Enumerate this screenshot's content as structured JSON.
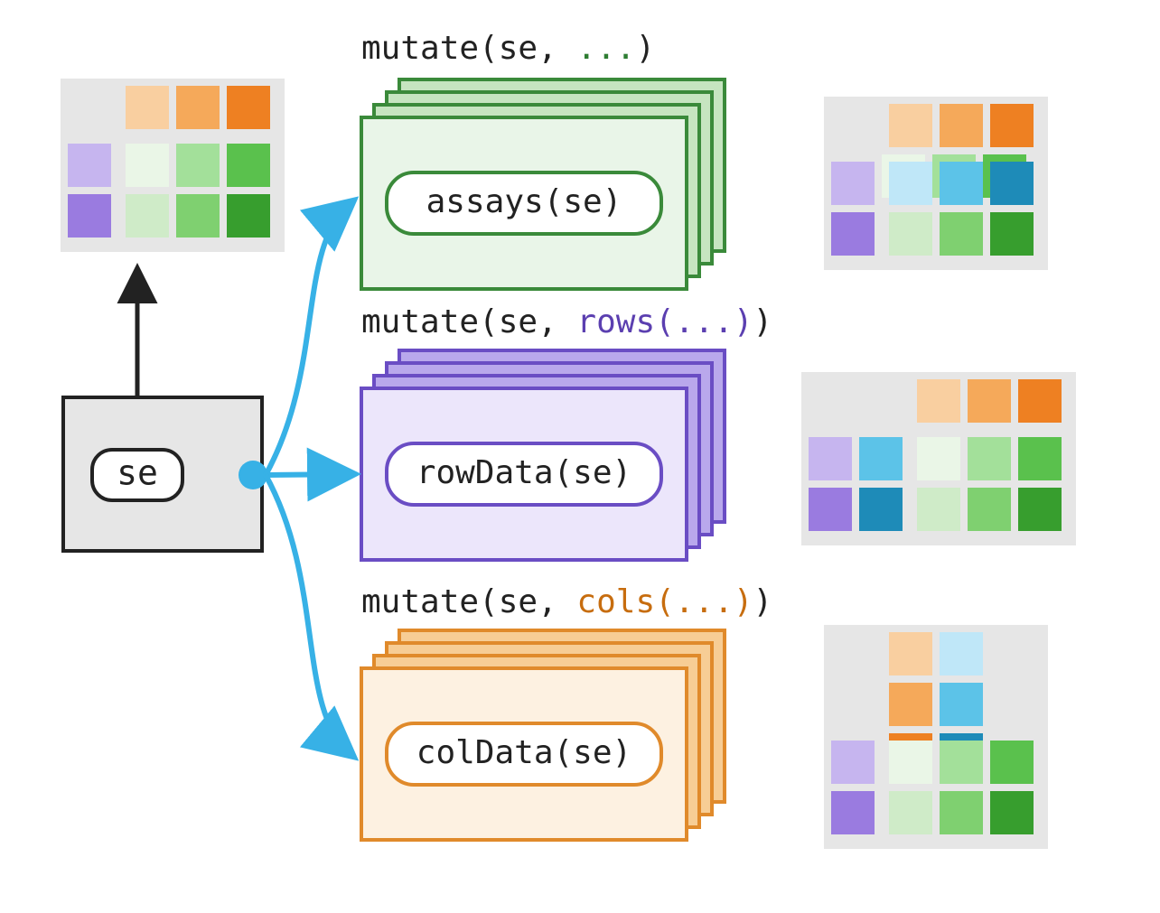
{
  "source": {
    "label": "se"
  },
  "targets": [
    {
      "id": "assays",
      "code": {
        "prefix": "mutate(se, ",
        "highlight": "...",
        "suffix": ")"
      },
      "pill": "assays(se)",
      "colors": {
        "stroke": "#3a8a3a",
        "fillLight": "#e9f5e8",
        "fillMid": "#c6e5c0",
        "text": "#2e7d32"
      }
    },
    {
      "id": "rowData",
      "code": {
        "prefix": "mutate(se, ",
        "highlight": "rows(...)",
        "suffix": ")"
      },
      "pill": "rowData(se)",
      "colors": {
        "stroke": "#6a4dc4",
        "fillLight": "#ece6fb",
        "fillMid": "#b9a8ec",
        "text": "#5b3fb0"
      }
    },
    {
      "id": "colData",
      "code": {
        "prefix": "mutate(se, ",
        "highlight": "cols(...)",
        "suffix": ")"
      },
      "pill": "colData(se)",
      "colors": {
        "stroke": "#e08a2b",
        "fillLight": "#fdf1e1",
        "fillMid": "#f7cd95",
        "text": "#c76d0f"
      }
    }
  ],
  "palette": {
    "oranges": [
      "#f9cfa0",
      "#f5a95a",
      "#ee8022"
    ],
    "purples": [
      "#c6b5ef",
      "#9a7be0"
    ],
    "greens": [
      "#eaf6e7",
      "#a3e09a",
      "#5ac14d",
      "#cfebc8",
      "#7fd070",
      "#379e2e"
    ],
    "blues": [
      "#bfe7f8",
      "#5cc3e8",
      "#1e8bb8"
    ],
    "gray": "#e6e6e6",
    "black": "#222222",
    "arrowBlue": "#37b1e6"
  },
  "glyphs": {
    "se_original": {
      "top": {
        "cells": [
          "oranges.0",
          "oranges.1",
          "oranges.2"
        ]
      },
      "left": {
        "cells": [
          "purples.0",
          "purples.1"
        ]
      },
      "body": {
        "rows": [
          [
            "greens.0",
            "greens.1",
            "greens.2"
          ],
          [
            "greens.3",
            "greens.4",
            "greens.5"
          ]
        ]
      }
    },
    "assays_result": {
      "top": {
        "cells": [
          "oranges.0",
          "oranges.1",
          "oranges.2"
        ]
      },
      "left": {
        "cells": [
          "purples.0",
          "purples.1"
        ]
      },
      "body": {
        "rows": [
          [
            "blues.0",
            "blues.1",
            "blues.2"
          ],
          [
            "greens.3",
            "greens.4",
            "greens.5"
          ]
        ]
      },
      "overlay": {
        "backRow": [
          "greens.0",
          "greens.1",
          "greens.2"
        ]
      }
    },
    "row_result": {
      "top": {
        "cells": [
          "oranges.0",
          "oranges.1",
          "oranges.2"
        ]
      },
      "left": {
        "cells": [
          [
            "purples.0",
            "blues.1"
          ],
          [
            "purples.1",
            "blues.2"
          ]
        ]
      },
      "body": {
        "rows": [
          [
            "greens.0",
            "greens.1",
            "greens.2"
          ],
          [
            "greens.3",
            "greens.4",
            "greens.5"
          ]
        ]
      }
    },
    "col_result": {
      "top": {
        "cells": [
          [
            "oranges.0",
            "oranges.1",
            "oranges.2"
          ],
          [
            "blues.0",
            "blues.1",
            "blues.2"
          ]
        ]
      },
      "left": {
        "cells": [
          "purples.0",
          "purples.1"
        ]
      },
      "body": {
        "rows": [
          [
            "greens.0",
            "greens.1",
            "greens.2"
          ],
          [
            "greens.3",
            "greens.4",
            "greens.5"
          ]
        ]
      }
    }
  }
}
